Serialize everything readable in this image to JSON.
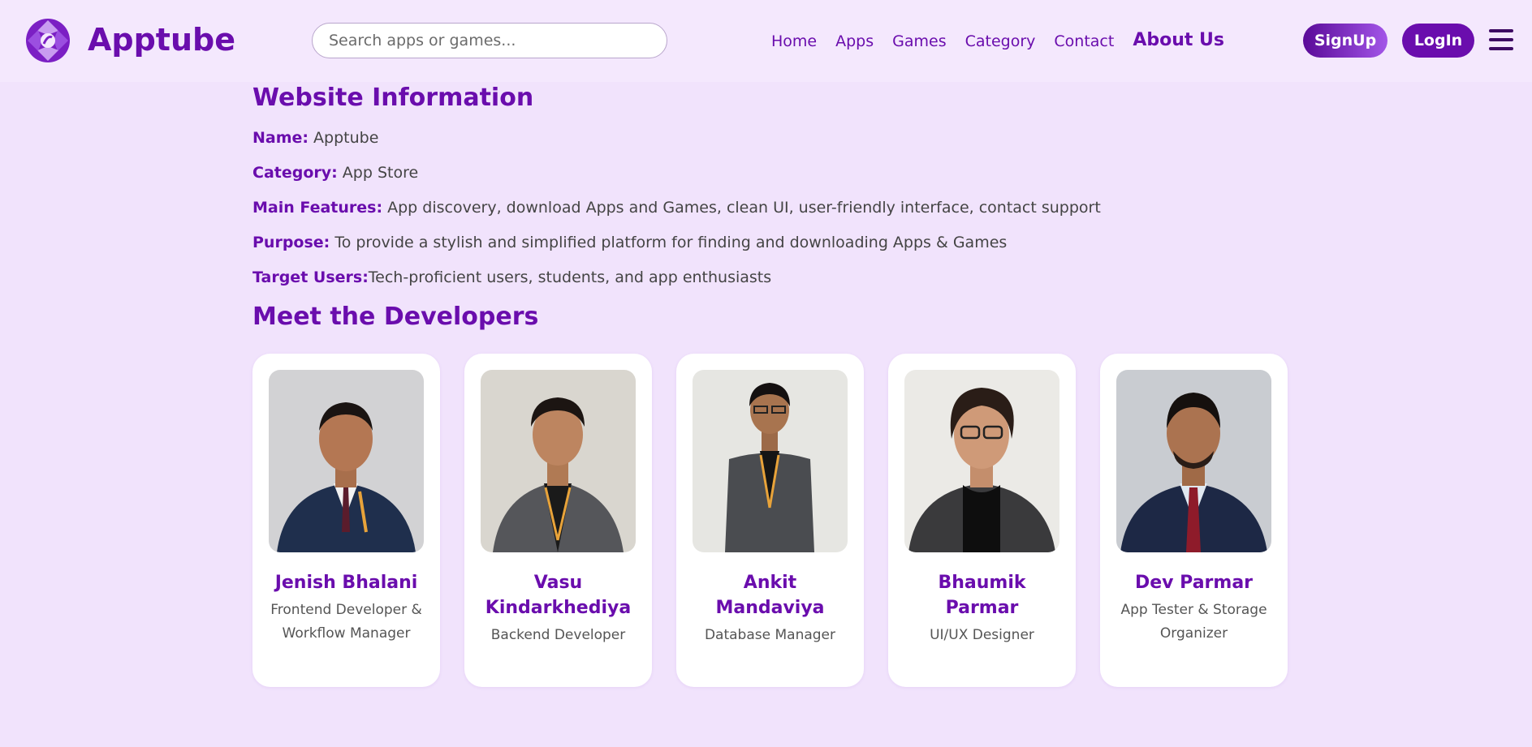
{
  "header": {
    "brand": "Apptube",
    "search_placeholder": "Search apps or games...",
    "nav": [
      "Home",
      "Apps",
      "Games",
      "Category",
      "Contact",
      "About Us"
    ],
    "active_nav": "About Us",
    "signup_label": "SignUp",
    "login_label": "LogIn"
  },
  "info": {
    "title": "Website Information",
    "rows": [
      {
        "key": "Name:",
        "value": " Apptube"
      },
      {
        "key": "Category:",
        "value": " App Store"
      },
      {
        "key": "Main Features:",
        "value": " App discovery, download Apps and Games, clean UI, user-friendly interface, contact support"
      },
      {
        "key": "Purpose:",
        "value": " To provide a stylish and simplified platform for finding and downloading Apps & Games"
      },
      {
        "key": "Target Users:",
        "value": "Tech-proficient users, students, and app enthusiasts"
      }
    ]
  },
  "developers": {
    "title": "Meet the Developers",
    "list": [
      {
        "name": "Jenish Bhalani",
        "role": "Frontend Developer & Workflow Manager"
      },
      {
        "name": "Vasu Kindarkhediya",
        "role": "Backend Developer"
      },
      {
        "name": "Ankit Mandaviya",
        "role": "Database Manager"
      },
      {
        "name": "Bhaumik Parmar",
        "role": "UI/UX Designer"
      },
      {
        "name": "Dev Parmar",
        "role": "App Tester & Storage Organizer"
      }
    ]
  },
  "colors": {
    "accent": "#6a0dad",
    "background": "#f1e3fc",
    "header_bg": "#f4e8fd"
  }
}
